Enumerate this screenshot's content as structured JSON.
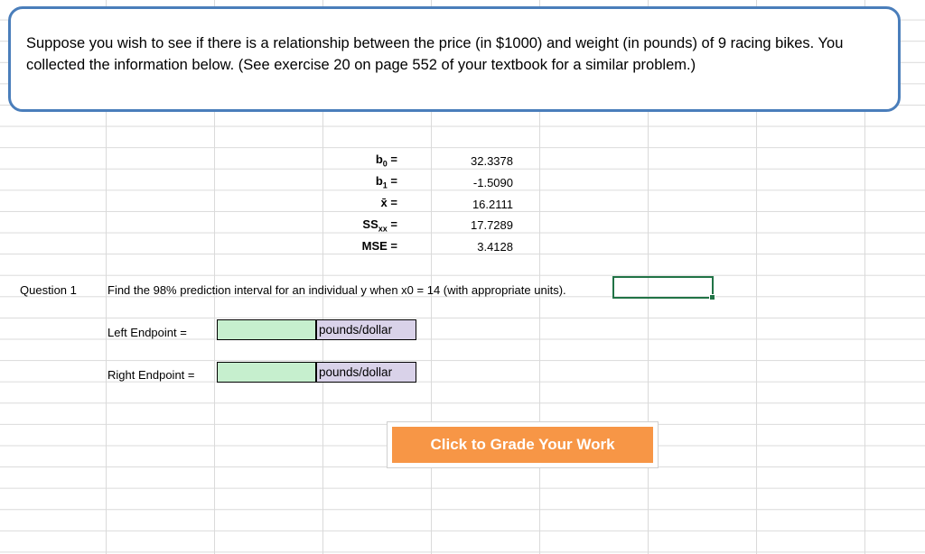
{
  "problem": {
    "text": "Suppose you wish to see if there is a relationship between the price (in $1000) and weight (in pounds) of 9 racing bikes.  You collected the information below.  (See exercise 20 on page 552 of your textbook for a similar problem.)"
  },
  "stats": [
    {
      "label_main": "b",
      "label_sub": "0",
      "label_suffix": " =",
      "value": "32.3378"
    },
    {
      "label_main": "b",
      "label_sub": "1",
      "label_suffix": " =",
      "value": "-1.5090"
    },
    {
      "label_main": "x̄",
      "label_sub": "",
      "label_suffix": " =",
      "value": "16.2111"
    },
    {
      "label_main": "SS",
      "label_sub": "xx",
      "label_suffix": " =",
      "value": "17.7289"
    },
    {
      "label_main": "MSE",
      "label_sub": "",
      "label_suffix": " =",
      "value": "3.4128"
    }
  ],
  "question": {
    "number_label": "Question 1",
    "prompt": "Find the 98% prediction interval for an individual y when x0 = 14 (with appropriate units)."
  },
  "answers": {
    "left_label": "Left Endpoint =",
    "left_value": "",
    "left_unit": "pounds/dollar",
    "right_label": "Right Endpoint =",
    "right_value": "",
    "right_unit": "pounds/dollar"
  },
  "grade_button": {
    "label": "Click to Grade Your Work"
  },
  "colors": {
    "box_border": "#4a7ebb",
    "input_fill": "#c6efce",
    "unit_fill": "#d9d2e9",
    "button_fill": "#f79646",
    "selection": "#217346"
  }
}
